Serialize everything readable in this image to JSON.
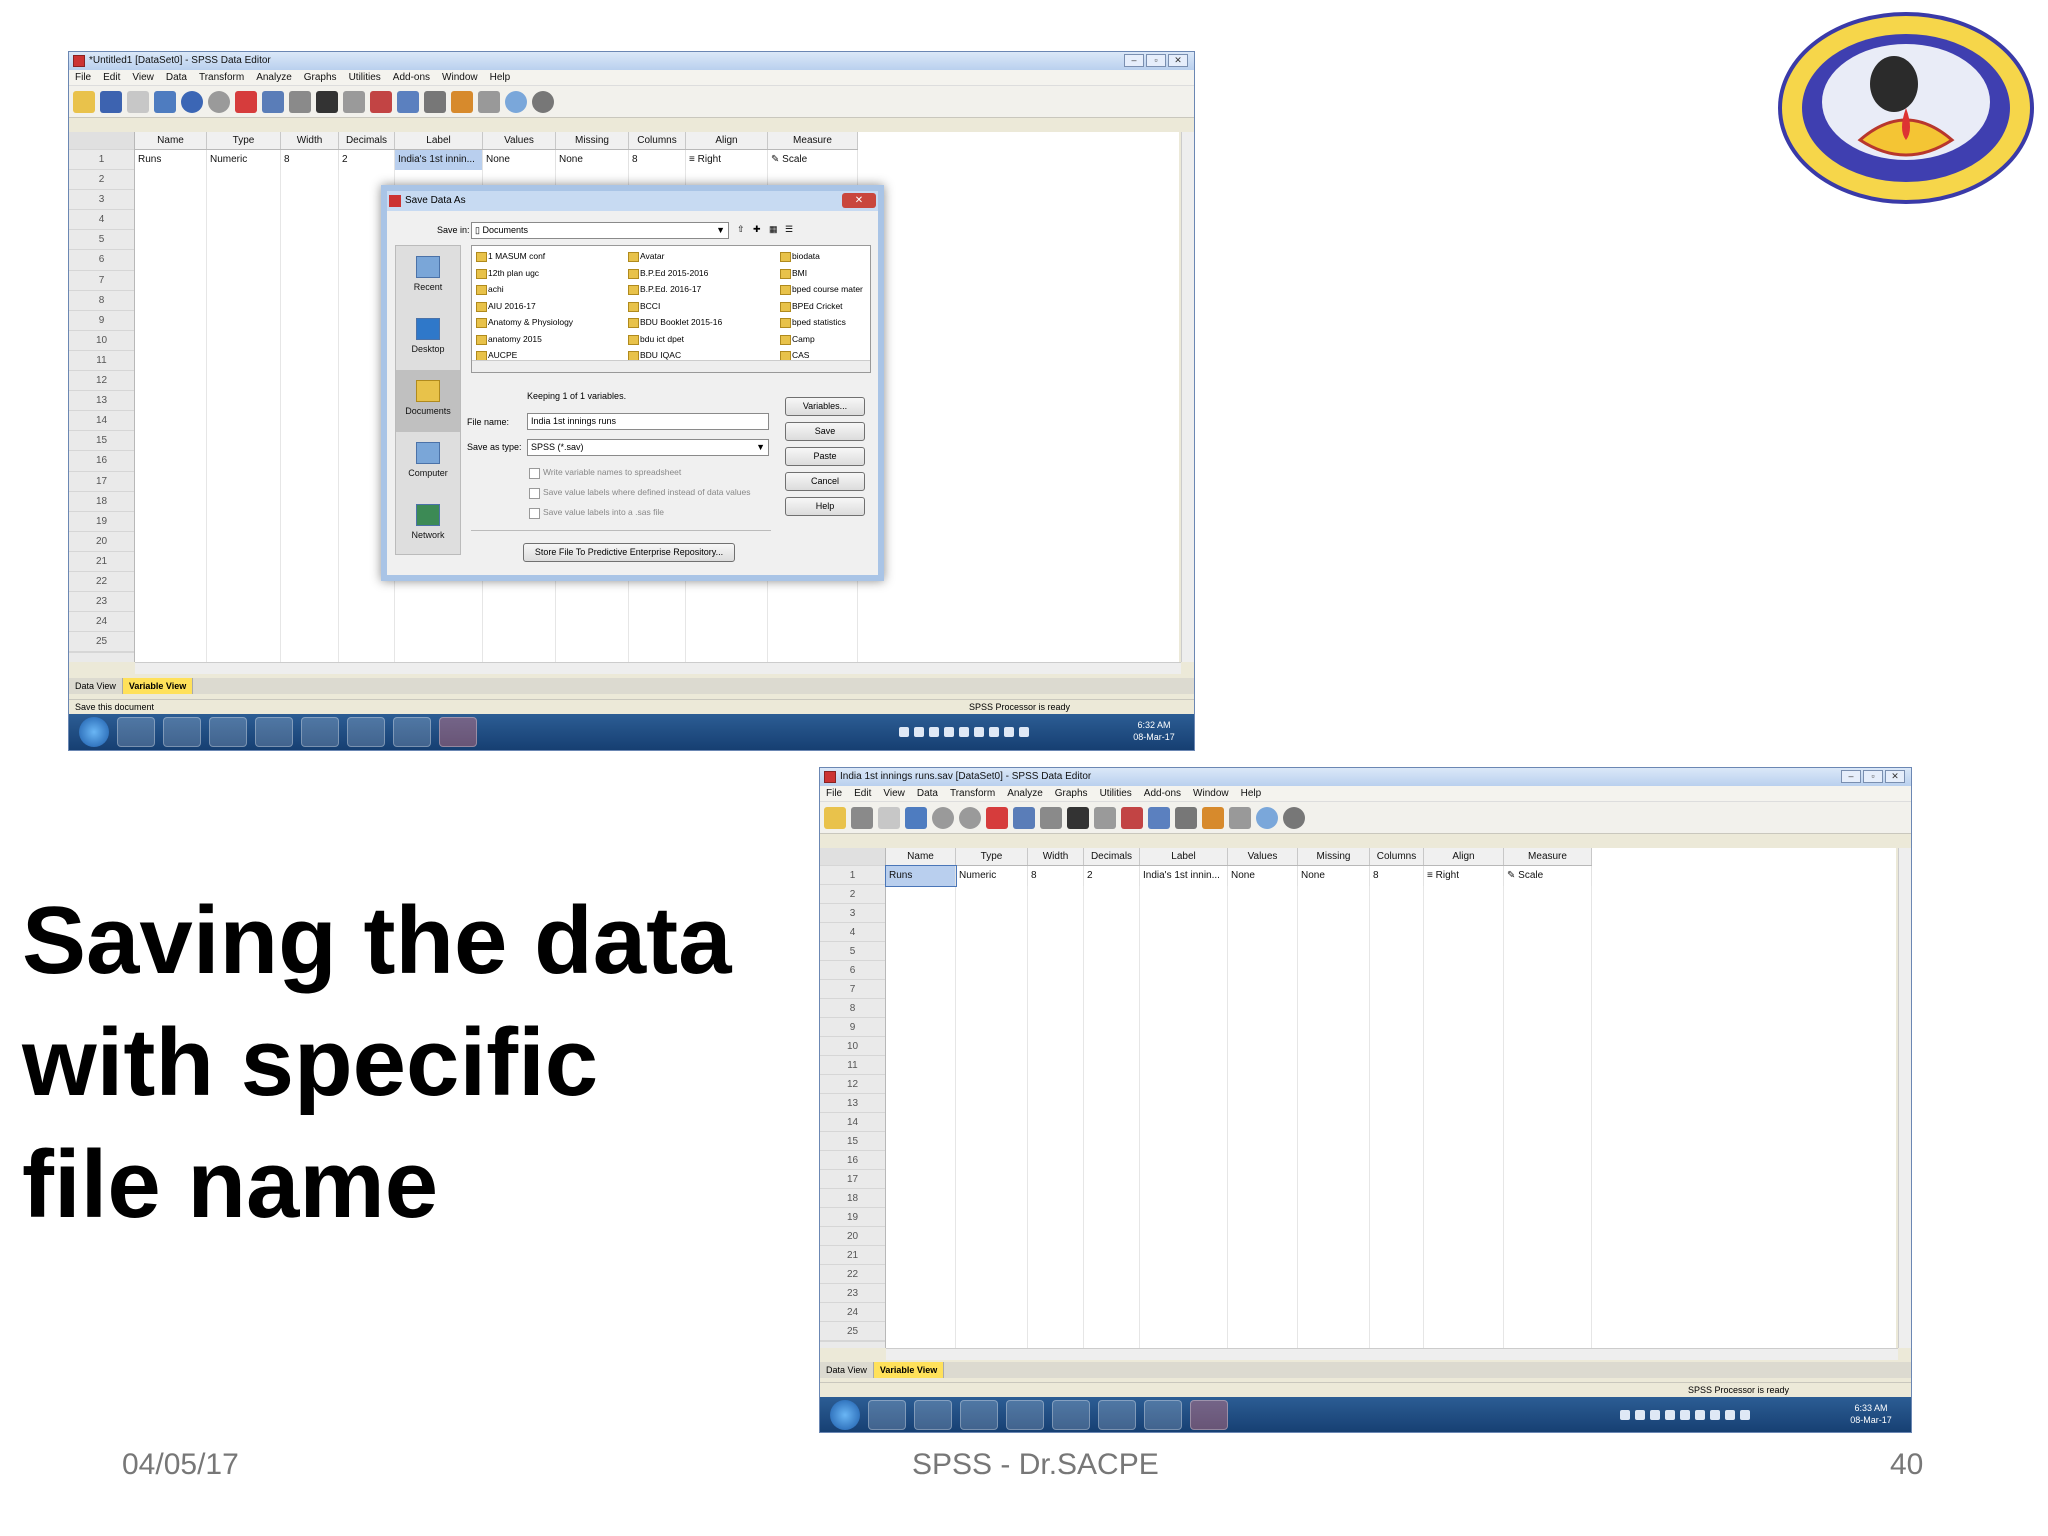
{
  "slide": {
    "heading_lines": [
      "Saving the data",
      "with specific",
      "file name"
    ],
    "footer_date": "04/05/17",
    "footer_center": "SPSS - Dr.SACPE",
    "footer_page": "40"
  },
  "screenshot1": {
    "title": "*Untitled1 [DataSet0] - SPSS Data Editor",
    "menu": [
      "File",
      "Edit",
      "View",
      "Data",
      "Transform",
      "Analyze",
      "Graphs",
      "Utilities",
      "Add-ons",
      "Window",
      "Help"
    ],
    "columns": [
      "Name",
      "Type",
      "Width",
      "Decimals",
      "Label",
      "Values",
      "Missing",
      "Columns",
      "Align",
      "Measure"
    ],
    "row1": [
      "Runs",
      "Numeric",
      "8",
      "2",
      "India's 1st innin...",
      "None",
      "None",
      "8",
      "Right",
      "Scale"
    ],
    "tabs": [
      "Data View",
      "Variable View"
    ],
    "status_left": "Save this document",
    "status_right": "SPSS Processor is ready",
    "clock_time": "6:32 AM",
    "clock_date": "08-Mar-17"
  },
  "dialog": {
    "title": "Save Data As",
    "save_in_label": "Save in:",
    "save_in_value": "Documents",
    "places": [
      "Recent",
      "Desktop",
      "Documents",
      "Computer",
      "Network"
    ],
    "files_col1": [
      "1 MASUM conf",
      "12th plan ugc",
      "achi",
      "AIU 2016-17",
      "Anatomy & Physiology",
      "anatomy 2015",
      "AUCPE"
    ],
    "files_col2": [
      "Avatar",
      "B.P.Ed 2015-2016",
      "B.P.Ed. 2016-17",
      "BCCI",
      "BDU Booklet 2015-16",
      "bdu ict dpet",
      "BDU IQAC"
    ],
    "files_col3": [
      "biodata",
      "BMI",
      "bped course mater",
      "BPEd Cricket",
      "bped statistics",
      "Camp",
      "CAS"
    ],
    "keeping_text": "Keeping 1 of 1 variables.",
    "file_name_label": "File name:",
    "file_name_value": "India 1st innings runs",
    "save_type_label": "Save as type:",
    "save_type_value": "SPSS (*.sav)",
    "checkbox1": "Write variable names to spreadsheet",
    "checkbox2": "Save value labels where defined instead of data values",
    "checkbox3": "Save value labels into a .sas file",
    "store_button": "Store File To Predictive Enterprise Repository...",
    "buttons": [
      "Variables...",
      "Save",
      "Paste",
      "Cancel",
      "Help"
    ]
  },
  "screenshot2": {
    "title": "India 1st innings runs.sav [DataSet0] - SPSS Data Editor",
    "menu": [
      "File",
      "Edit",
      "View",
      "Data",
      "Transform",
      "Analyze",
      "Graphs",
      "Utilities",
      "Add-ons",
      "Window",
      "Help"
    ],
    "columns": [
      "Name",
      "Type",
      "Width",
      "Decimals",
      "Label",
      "Values",
      "Missing",
      "Columns",
      "Align",
      "Measure"
    ],
    "row1": [
      "Runs",
      "Numeric",
      "8",
      "2",
      "India's 1st innin...",
      "None",
      "None",
      "8",
      "Right",
      "Scale"
    ],
    "tabs": [
      "Data View",
      "Variable View"
    ],
    "status_right": "SPSS Processor is ready",
    "clock_time": "6:33 AM",
    "clock_date": "08-Mar-17"
  },
  "colors": {
    "selected_tab": "#ffe15a",
    "taskbar": "#1f4c84",
    "selected_cell": "#b9cfee"
  }
}
